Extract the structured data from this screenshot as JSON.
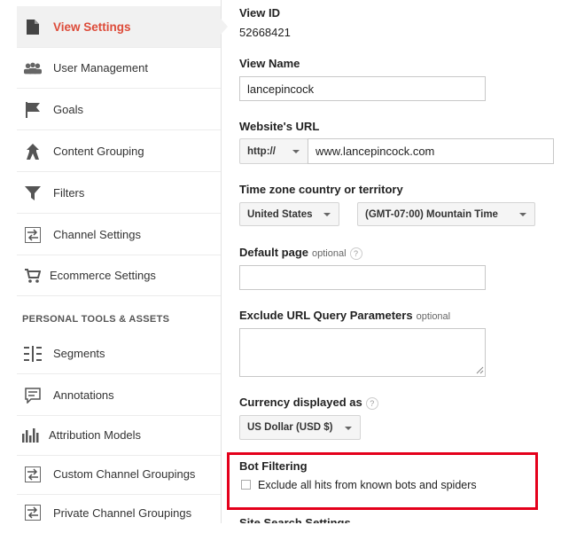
{
  "sidebar": {
    "items": [
      {
        "label": "View Settings",
        "icon": "document-icon"
      },
      {
        "label": "User Management",
        "icon": "users-icon"
      },
      {
        "label": "Goals",
        "icon": "flag-icon"
      },
      {
        "label": "Content Grouping",
        "icon": "content-grouping-icon"
      },
      {
        "label": "Filters",
        "icon": "filter-icon"
      },
      {
        "label": "Channel Settings",
        "icon": "channel-icon"
      },
      {
        "label": "Ecommerce Settings",
        "icon": "cart-icon"
      }
    ],
    "section_heading": "PERSONAL TOOLS & ASSETS",
    "tools": [
      {
        "label": "Segments",
        "icon": "segments-icon"
      },
      {
        "label": "Annotations",
        "icon": "annotation-icon"
      },
      {
        "label": "Attribution Models",
        "icon": "bar-chart-icon"
      },
      {
        "label": "Custom Channel Groupings",
        "icon": "channel-icon"
      },
      {
        "label": "Private Channel Groupings",
        "icon": "channel-icon"
      }
    ],
    "active_color": "#dd4b39"
  },
  "main": {
    "view_id_label": "View ID",
    "view_id_value": "52668421",
    "view_name_label": "View Name",
    "view_name_value": "lancepincock",
    "website_url_label": "Website's URL",
    "protocol_value": "http://",
    "url_value": "www.lancepincock.com",
    "timezone_label": "Time zone country or territory",
    "country_value": "United States",
    "timezone_value": "(GMT-07:00) Mountain Time",
    "default_page_label": "Default page",
    "default_page_optional": "optional",
    "default_page_value": "",
    "exclude_params_label": "Exclude URL Query Parameters",
    "exclude_params_optional": "optional",
    "exclude_params_value": "",
    "currency_label": "Currency displayed as",
    "currency_value": "US Dollar (USD $)",
    "bot_filtering_label": "Bot Filtering",
    "bot_filtering_checkbox_label": "Exclude all hits from known bots and spiders",
    "bot_filtering_checked": false,
    "next_section_label": "Site Search Settings",
    "help_glyph": "?"
  },
  "highlight_color": "#e4001b"
}
